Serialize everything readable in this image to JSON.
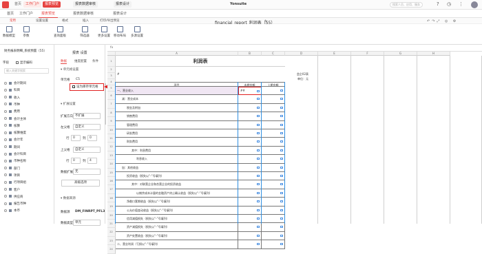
{
  "topbar": {
    "tabs": [
      "首页",
      "工作门户",
      "报表预览",
      "报表数据审核",
      "报表设计"
    ],
    "brand": "Yonsuite",
    "search_placeholder": "搜索人员、应用、服务"
  },
  "page_tabs": [
    "首页",
    "工作门户",
    "报表预览",
    "报表数据审核",
    "报表设计"
  ],
  "menu": [
    "常用",
    "设置设置",
    "格式",
    "插入",
    "打印/导出预览"
  ],
  "filename": "financial_report_利润表（55）",
  "toolbar": [
    "数据模型",
    "参数",
    "查询面板",
    "筛选器",
    "更多设置",
    "移动布局",
    "多源设置"
  ],
  "sidebar": {
    "title": "财务报表明细_系统预置（55）",
    "field_label": "字段",
    "show_check": "显示编码",
    "search_placeholder": "输入关键字搜索",
    "items": [
      "会计期间",
      "科目",
      "收入",
      "币种",
      "费用",
      "会计主体",
      "核算",
      "核算维度",
      "会计年",
      "期间",
      "会计科目",
      "币种名称",
      "部门",
      "项目",
      "行项目组",
      "客户",
      "供应商",
      "报告币种",
      "本币"
    ]
  },
  "panel": {
    "title": "报表 设置",
    "tabs": [
      "数据",
      "维度配置",
      "条件"
    ],
    "section1": "单元格设置",
    "cell_label": "单元格",
    "cell_value": "C5",
    "checkbox_label": "设为库存单元格",
    "section2": "扩展设置",
    "expand_dir_label": "扩展方向",
    "expand_dir_value": "不扩展",
    "left_parent_label": "左父格",
    "left_parent_value": "自定义",
    "left_row": "行",
    "left_row_value": "0",
    "left_col": "列",
    "left_col_value": "0",
    "top_parent_label": "上父格",
    "top_parent_value": "自定义",
    "top_row": "行",
    "top_row_value": "0",
    "top_col": "列",
    "top_col_value": "4",
    "data_expand_label": "数据扩展",
    "data_expand_value": "无",
    "button": "高级选项",
    "section3": "数据来源",
    "source_label": "数据源",
    "source_value": "DM_FINRPT_PFL3",
    "field_type_label": "数据类型",
    "field_type_value": "单元"
  },
  "sheet": {
    "columns": [
      "A",
      "B",
      "C",
      "D",
      "E",
      "F",
      "G",
      "H"
    ],
    "title": "利润表",
    "unit1": "会企02表",
    "unit2": "单位：元",
    "hash": "#",
    "head": [
      "项目",
      "本期金额",
      "上期金额"
    ],
    "rows": [
      {
        "label": "一、营业收入",
        "indent": 0
      },
      {
        "label": "减：营业成本",
        "indent": 1
      },
      {
        "label": "税金及附加",
        "indent": 2
      },
      {
        "label": "销售费用",
        "indent": 2
      },
      {
        "label": "管理费用",
        "indent": 2
      },
      {
        "label": "研发费用",
        "indent": 2
      },
      {
        "label": "财务费用",
        "indent": 2
      },
      {
        "label": "其中：利息费用",
        "indent": 3
      },
      {
        "label": "利息收入",
        "indent": 4
      },
      {
        "label": "加：其他收益",
        "indent": 1
      },
      {
        "label": "投资收益（损失以“-”号填列）",
        "indent": 2
      },
      {
        "label": "其中：对联营企业和合营企业的投资收益",
        "indent": 3
      },
      {
        "label": "以摊余成本计量的金融资产终止确认收益（损失以“-”号填列）",
        "indent": 4
      },
      {
        "label": "净敞口套期收益（损失以“-”号填列）",
        "indent": 2
      },
      {
        "label": "公允价值变动收益（损失以“-”号填列）",
        "indent": 2
      },
      {
        "label": "信用减值损失（损失以“-”号填列）",
        "indent": 2
      },
      {
        "label": "资产减值损失（损失以“-”号填列）",
        "indent": 2
      },
      {
        "label": "资产处置收益（损失以“-”号填列）",
        "indent": 2
      },
      {
        "label": "二、营业利润（亏损以“-”号填列）",
        "indent": 0
      }
    ]
  },
  "colors": {
    "accent": "#e64340",
    "selection": "#2e8de0",
    "highlight": "#e02020"
  }
}
